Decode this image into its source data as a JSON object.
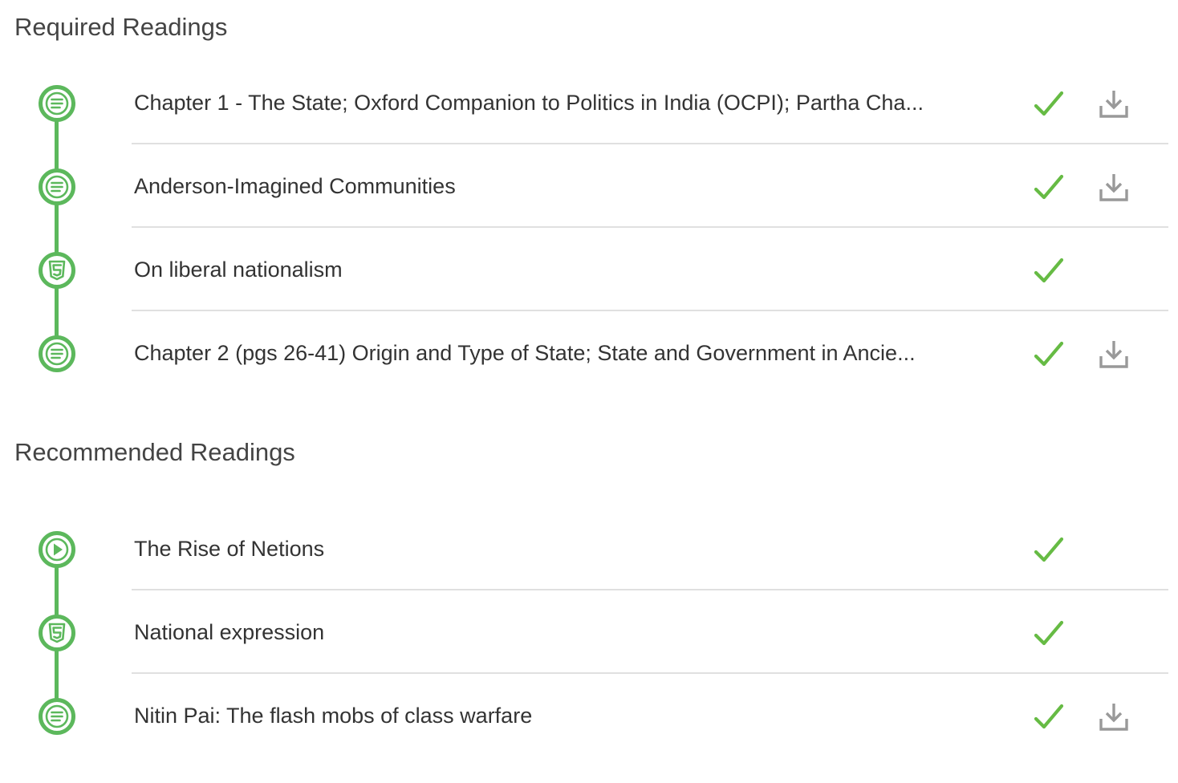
{
  "colors": {
    "accent_green": "#5cb85c",
    "check_green": "#66bb44",
    "icon_gray": "#999999",
    "divider": "#e0e0e0",
    "title_text": "#444444",
    "item_text": "#333333"
  },
  "required": {
    "title": "Required Readings",
    "items": [
      {
        "title": "Chapter 1 - The State; Oxford Companion to Politics in India (OCPI); Partha Cha...",
        "type_icon": "document-icon",
        "completed": true,
        "downloadable": true
      },
      {
        "title": "Anderson-Imagined Communities",
        "type_icon": "document-icon",
        "completed": true,
        "downloadable": true
      },
      {
        "title": "On liberal nationalism",
        "type_icon": "html5-icon",
        "completed": true,
        "downloadable": false
      },
      {
        "title": "Chapter 2 (pgs 26-41) Origin and Type of State; State and Government in Ancie...",
        "type_icon": "document-icon",
        "completed": true,
        "downloadable": true
      }
    ]
  },
  "recommended": {
    "title": "Recommended Readings",
    "items": [
      {
        "title": "The Rise of Netions",
        "type_icon": "video-play-icon",
        "completed": true,
        "downloadable": false
      },
      {
        "title": "National expression",
        "type_icon": "html5-icon",
        "completed": true,
        "downloadable": false
      },
      {
        "title": "Nitin Pai: The flash mobs of class warfare",
        "type_icon": "document-icon",
        "completed": true,
        "downloadable": true
      }
    ]
  }
}
